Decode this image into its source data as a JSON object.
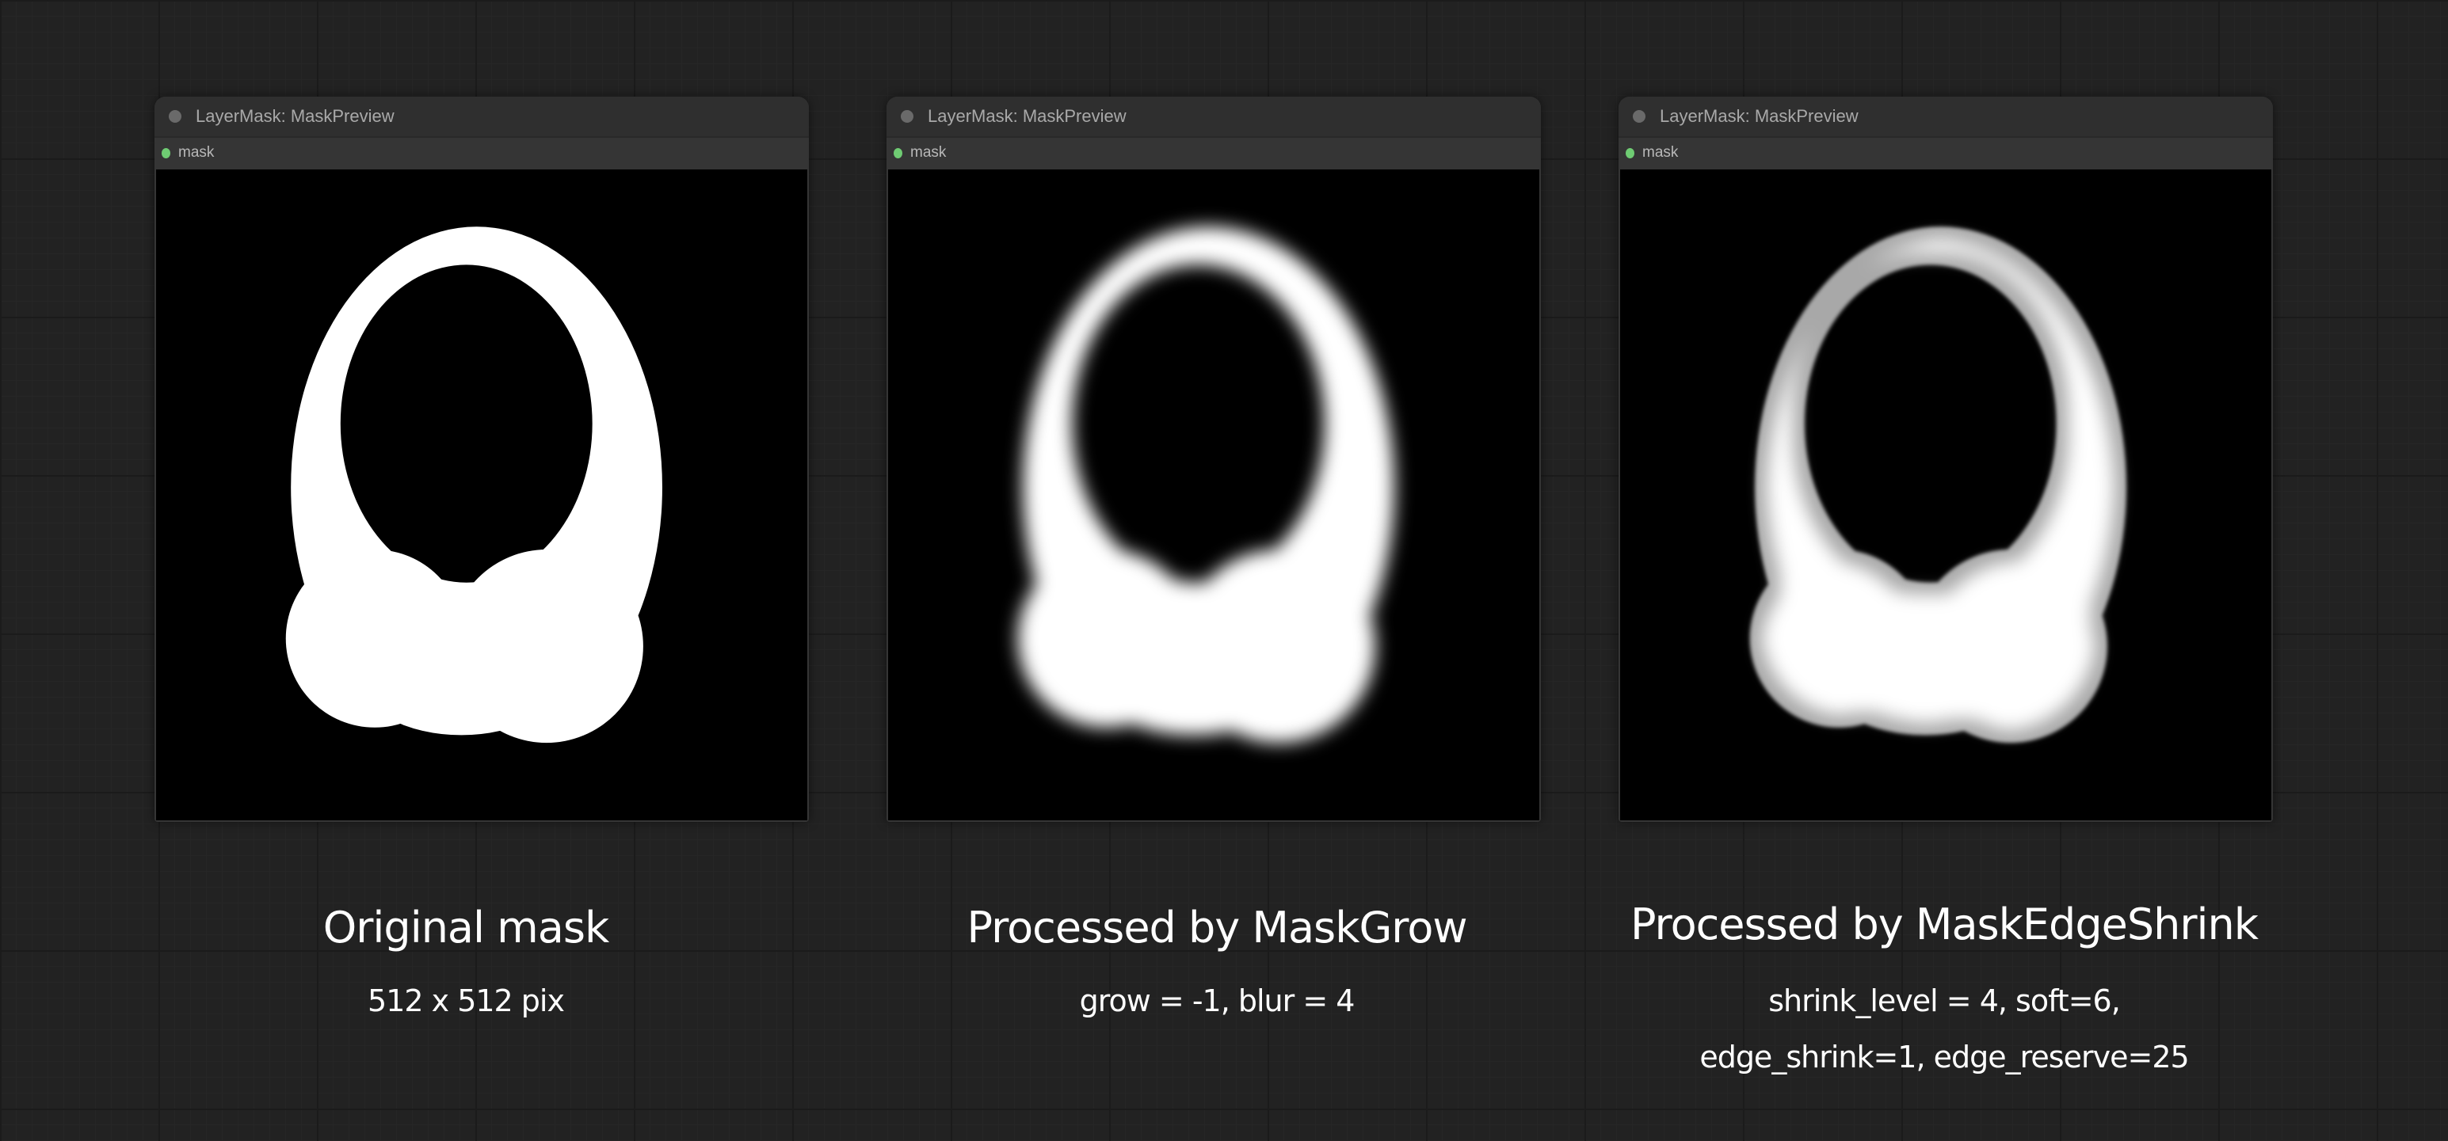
{
  "nodes": [
    {
      "title": "LayerMask: MaskPreview",
      "slot_label": "mask",
      "caption": "Original mask",
      "details": [
        "512 x 512 pix"
      ]
    },
    {
      "title": "LayerMask: MaskPreview",
      "slot_label": "mask",
      "caption": "Processed by MaskGrow",
      "details": [
        "grow = -1, blur = 4"
      ]
    },
    {
      "title": "LayerMask: MaskPreview",
      "slot_label": "mask",
      "caption": "Processed by MaskEdgeShrink",
      "details": [
        "shrink_level = 4, soft=6,",
        "edge_shrink=1, edge_reserve=25"
      ]
    }
  ],
  "colors": {
    "slot_dot": "#6fcc73",
    "title_dot": "#6a6a6a",
    "canvas_bg": "#222222"
  }
}
